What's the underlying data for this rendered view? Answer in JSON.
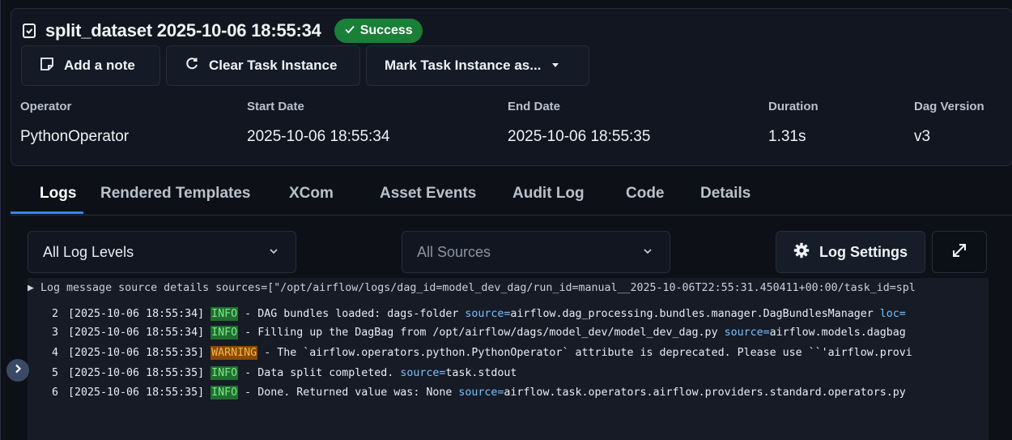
{
  "header": {
    "title": "split_dataset 2025-10-06 18:55:34",
    "status": "Success",
    "status_color": "#1a7f37"
  },
  "actions": {
    "add_note": "Add a note",
    "clear": "Clear Task Instance",
    "mark": "Mark Task Instance as..."
  },
  "meta": {
    "labels": [
      "Operator",
      "Start Date",
      "End Date",
      "Duration",
      "Dag Version"
    ],
    "values": [
      "PythonOperator",
      "2025-10-06 18:55:34",
      "2025-10-06 18:55:35",
      "1.31s",
      "v3"
    ]
  },
  "tabs": [
    "Logs",
    "Rendered Templates",
    "XCom",
    "Asset Events",
    "Audit Log",
    "Code",
    "Details"
  ],
  "active_tab": "Logs",
  "filters": {
    "levels": "All Log Levels",
    "sources": "All Sources",
    "settings": "Log Settings"
  },
  "log": {
    "source_line": "▶ Log message source details sources=[\"/opt/airflow/logs/dag_id=model_dev_dag/run_id=manual__2025-10-06T22:55:31.450411+00:00/task_id=spl",
    "lines": [
      {
        "n": "2",
        "ts": "[2025-10-06 18:55:34]",
        "level": "INFO",
        "msg": " - DAG bundles loaded: dags-folder ",
        "src": "source=",
        "src_val": "airflow.dag_processing.bundles.manager.DagBundlesManager ",
        "extra": "loc="
      },
      {
        "n": "3",
        "ts": "[2025-10-06 18:55:34]",
        "level": "INFO",
        "msg": " - Filling up the DagBag from /opt/airflow/dags/model_dev/model_dev_dag.py ",
        "src": "source=",
        "src_val": "airflow.models.dagbag",
        "extra": ""
      },
      {
        "n": "4",
        "ts": "[2025-10-06 18:55:35]",
        "level": "WARNING",
        "msg": " - The `airflow.operators.python.PythonOperator` attribute is deprecated. Please use ``'airflow.provi",
        "src": "",
        "src_val": "",
        "extra": ""
      },
      {
        "n": "5",
        "ts": "[2025-10-06 18:55:35]",
        "level": "INFO",
        "msg": " - Data split completed. ",
        "src": "source=",
        "src_val": "task.stdout",
        "extra": ""
      },
      {
        "n": "6",
        "ts": "[2025-10-06 18:55:35]",
        "level": "INFO",
        "msg": " - Done. Returned value was: None ",
        "src": "source=",
        "src_val": "airflow.task.operators.airflow.providers.standard.operators.py",
        "extra": ""
      }
    ]
  }
}
